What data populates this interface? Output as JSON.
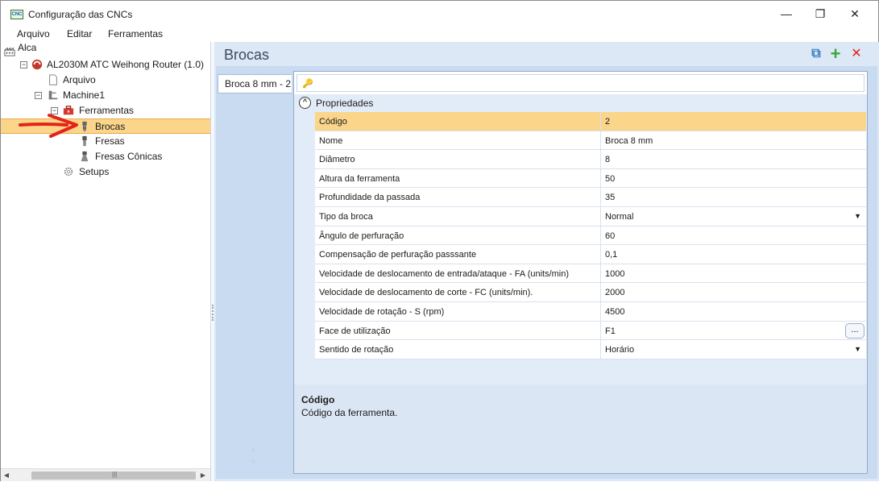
{
  "window": {
    "title": "Configuração das CNCs",
    "app_icon_text": "CNC",
    "controls": {
      "minimize": "—",
      "restore": "❐",
      "close": "✕"
    }
  },
  "menu": [
    "Arquivo",
    "Editar",
    "Ferramentas"
  ],
  "tree": {
    "items": [
      {
        "label": "Alca",
        "icon": "factory-icon",
        "indent": 0,
        "expander": ""
      },
      {
        "label": "AL2030M ATC Weihong Router (1.0)",
        "icon": "machine-red-icon",
        "indent": 1,
        "expander": "−"
      },
      {
        "label": "Arquivo",
        "icon": "file-icon",
        "indent": 2,
        "expander": ""
      },
      {
        "label": "Machine1",
        "icon": "machine-icon",
        "indent": 2,
        "expander": "−"
      },
      {
        "label": "Ferramentas",
        "icon": "toolbox-icon",
        "indent": 3,
        "expander": "−"
      },
      {
        "label": "Brocas",
        "icon": "drill-icon",
        "indent": 4,
        "expander": "",
        "selected": true
      },
      {
        "label": "Fresas",
        "icon": "mill-icon",
        "indent": 4,
        "expander": ""
      },
      {
        "label": "Fresas Cônicas",
        "icon": "conical-mill-icon",
        "indent": 4,
        "expander": ""
      },
      {
        "label": "Setups",
        "icon": "gear-icon",
        "indent": 3,
        "expander": ""
      }
    ],
    "scroll_grip": "|||"
  },
  "panel": {
    "title": "Brocas",
    "buttons": {
      "copy": "⧉",
      "add": "+",
      "remove": "✕"
    },
    "tabs": [
      "Broca 8 mm - 2"
    ]
  },
  "properties": {
    "search_placeholder": "",
    "category": "Propriedades",
    "rows": [
      {
        "name": "Código",
        "value": "2",
        "selected": true,
        "editor": ""
      },
      {
        "name": "Nome",
        "value": "Broca 8 mm",
        "editor": ""
      },
      {
        "name": "Diâmetro",
        "value": "8",
        "editor": ""
      },
      {
        "name": "Altura da ferramenta",
        "value": "50",
        "editor": ""
      },
      {
        "name": "Profundidade da passada",
        "value": "35",
        "editor": ""
      },
      {
        "name": "Tipo da broca",
        "value": "Normal",
        "editor": "dropdown"
      },
      {
        "name": "Ângulo de perfuração",
        "value": "60",
        "editor": ""
      },
      {
        "name": "Compensação de perfuração passsante",
        "value": "0,1",
        "editor": ""
      },
      {
        "name": "Velocidade de deslocamento de entrada/ataque - FA (units/min)",
        "value": "1000",
        "editor": ""
      },
      {
        "name": "Velocidade de deslocamento de corte - FC (units/min).",
        "value": "2000",
        "editor": ""
      },
      {
        "name": "Velocidade de rotação - S (rpm)",
        "value": "4500",
        "editor": ""
      },
      {
        "name": "Face de utilização",
        "value": "F1",
        "editor": "ellipsis"
      },
      {
        "name": "Sentido de rotação",
        "value": "Horário",
        "editor": "dropdown"
      }
    ],
    "ellipsis_label": "...",
    "dropdown_glyph": "▼"
  },
  "description": {
    "title": "Código",
    "text": "Código da ferramenta."
  },
  "colors": {
    "selection": "#fbd68a",
    "panel_bg": "#dde8f6",
    "header_text": "#3b4a5e"
  }
}
